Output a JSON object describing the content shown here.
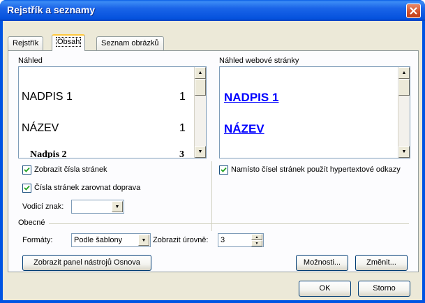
{
  "window": {
    "title": "Rejstřík a seznamy"
  },
  "tabs": [
    {
      "label": "Rejstřík"
    },
    {
      "label": "Obsah"
    },
    {
      "label": "Seznam obrázků"
    }
  ],
  "print_preview": {
    "label": "Náhled",
    "entries": [
      {
        "text": "NADPIS 1",
        "page": "1"
      },
      {
        "text": "NÁZEV",
        "page": "1"
      },
      {
        "text": "Nadpis 2",
        "page": "3"
      }
    ]
  },
  "web_preview": {
    "label": "Náhled webové stránky",
    "entries": [
      {
        "text": "NADPIS 1"
      },
      {
        "text": "NÁZEV"
      }
    ]
  },
  "options": {
    "show_page_numbers": {
      "label": "Zobrazit čísla stránek",
      "checked": true
    },
    "right_align": {
      "label": "Čísla stránek zarovnat doprava",
      "checked": true
    },
    "hyperlinks": {
      "label": "Namísto čísel stránek použít hypertextové odkazy",
      "checked": true
    },
    "leader_label": "Vodicí znak:",
    "leader_value": ""
  },
  "general": {
    "section_label": "Obecné",
    "formats_label": "Formáty:",
    "formats_value": "Podle šablony",
    "levels_label": "Zobrazit úrovně:",
    "levels_value": "3"
  },
  "buttons": {
    "outline_toolbar": "Zobrazit panel nástrojů Osnova",
    "options": "Možnosti...",
    "modify": "Změnit...",
    "ok": "OK",
    "cancel": "Storno"
  },
  "icons": {
    "close": "close-icon",
    "scroll_up": "arrow-up-icon",
    "scroll_down": "arrow-down-icon",
    "dropdown": "chevron-down-icon",
    "check": "check-icon"
  },
  "colors": {
    "title_bar": "#0054e3",
    "dialog_face": "#ece9d8",
    "link": "#0000ff",
    "close_button": "#d2512a"
  }
}
